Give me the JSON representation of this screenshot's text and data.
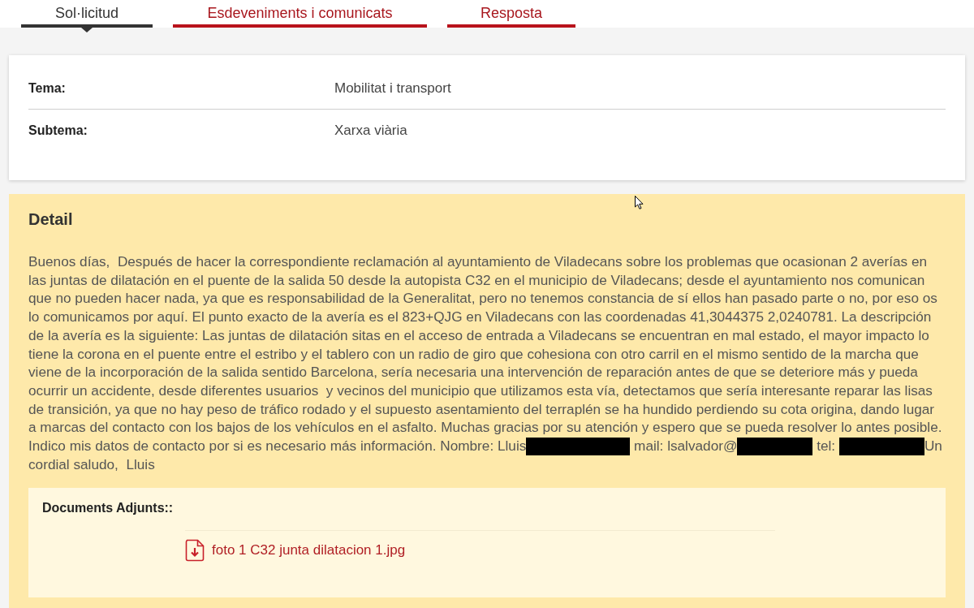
{
  "tabs": [
    {
      "label": "Sol·licitud",
      "selected": true
    },
    {
      "label": "Esdeveniments i comunicats",
      "selected": false
    },
    {
      "label": "Resposta",
      "selected": false
    }
  ],
  "summary": {
    "fields": [
      {
        "label": "Tema:",
        "value": "Mobilitat i transport"
      },
      {
        "label": "Subtema:",
        "value": "Xarxa viària"
      }
    ]
  },
  "detail": {
    "title": "Detail",
    "body": [
      {
        "kind": "text",
        "text": "Buenos días,  Después de hacer la correspondiente reclamación al ayuntamiento de Viladecans sobre los problemas que ocasionan 2 averías en las juntas de dilatación en el puente de la salida 50 desde la autopista C32 en el municipio de Viladecans; desde el ayuntamiento nos comunican que no pueden hacer nada, ya que es responsabilidad de la Generalitat, pero no tenemos constancia de sí ellos han pasado parte o no, por eso os lo comunicamos por aquí. El punto exacto de la avería es el 823+QJG en Viladecans con las coordenadas 41,3044375 2,0240781. La descripción de la avería es la siguiente: Las juntas de dilatación sitas en el acceso de entrada a Viladecans se encuentran en mal estado, el mayor impacto lo tiene la corona en el puente entre el estribo y el tablero con un radio de giro que cohesiona con otro carril en el mismo sentido de la marcha que viene de la incorporación de la salida sentido Barcelona, sería necesaria una intervención de reparación antes de que se deteriore más y pueda ocurrir un accidente, desde diferentes usuarios  y vecinos del municipio que utilizamos esta vía, detectamos que sería interesante reparar las lisas de transición, ya que no hay peso de tráfico rodado y el supuesto asentamiento del terraplén se ha hundido perdiendo su cota origina, dando lugar a marcas del contacto con los bajos de los vehículos en el asfalto. Muchas gracias por su atención y espero que se pueda resolver lo antes posible. Indico mis datos de contacto por si es necesario más información. Nombre: Lluis"
      },
      {
        "kind": "redacted"
      },
      {
        "kind": "text",
        "text": " mail: lsalvador@"
      },
      {
        "kind": "redacted"
      },
      {
        "kind": "text",
        "text": " tel: "
      },
      {
        "kind": "redacted"
      },
      {
        "kind": "text",
        "text": "Un cordial saludo,  Lluis"
      }
    ],
    "attachments": {
      "heading": "Documents Adjunts::",
      "files": [
        {
          "name": "foto 1 C32 junta dilatacion 1.jpg"
        }
      ]
    }
  }
}
